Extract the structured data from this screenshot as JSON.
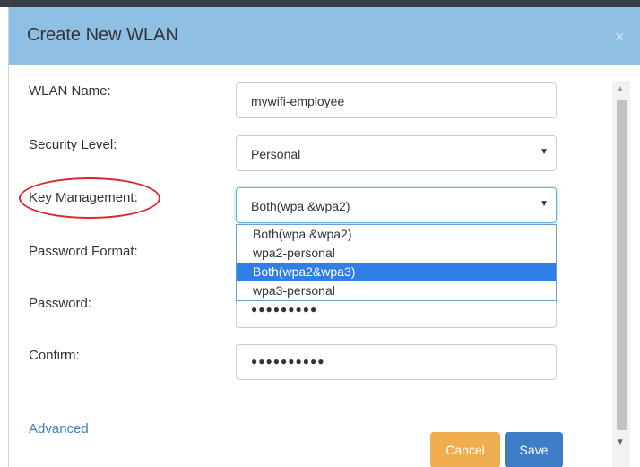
{
  "dialog": {
    "title": "Create New WLAN",
    "close_icon": "×"
  },
  "form": {
    "wlan_name": {
      "label": "WLAN Name:",
      "value": "mywifi-employee"
    },
    "security_level": {
      "label": "Security Level:",
      "value": "Personal"
    },
    "key_management": {
      "label": "Key Management:",
      "value": "Both(wpa &wpa2)",
      "options": [
        "Both(wpa &wpa2)",
        "wpa2-personal",
        "Both(wpa2&wpa3)",
        "wpa3-personal"
      ],
      "highlighted_option": "Both(wpa2&wpa3)"
    },
    "password_format": {
      "label": "Password Format:"
    },
    "password": {
      "label": "Password:",
      "masked_value": "●●●●●●●●●"
    },
    "confirm": {
      "label": "Confirm:",
      "masked_value": "●●●●●●●●●●"
    }
  },
  "advanced_link": "Advanced",
  "buttons": {
    "cancel": "Cancel",
    "save": "Save"
  },
  "scrollbar": {
    "up_arrow": "▲",
    "down_arrow": "▼"
  },
  "caret_glyph": "▼",
  "colors": {
    "header": "#8fbfe3",
    "highlight_annotation": "#d7262c",
    "selected_option": "#2f7fe6",
    "cancel_button": "#f0ad4e",
    "save_button": "#3d7dc6",
    "link": "#3a7fc1"
  },
  "icons": {
    "close": "close-icon",
    "dropdown": "chevron-down-icon",
    "scroll_up": "scroll-up-arrow-icon",
    "scroll_down": "scroll-down-arrow-icon"
  }
}
